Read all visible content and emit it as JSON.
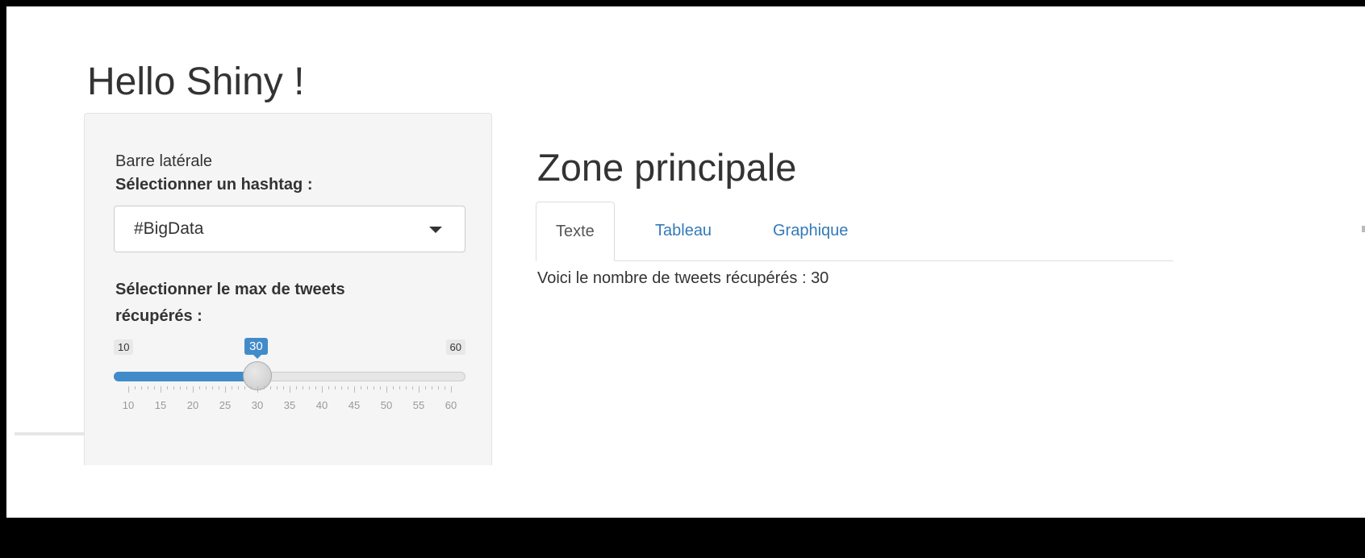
{
  "app": {
    "title": "Hello Shiny !"
  },
  "sidebar": {
    "caption": "Barre latérale",
    "hashtag_label": "Sélectionner un hashtag :",
    "hashtag_value": "#BigData",
    "max_label_line1": "Sélectionner le max de tweets",
    "max_label_line2": "récupérés :",
    "slider": {
      "min": 10,
      "max": 60,
      "value": 30,
      "min_label": "10",
      "max_label": "60",
      "value_label": "30",
      "tick_labels": [
        "10",
        "15",
        "20",
        "25",
        "30",
        "35",
        "40",
        "45",
        "50",
        "55",
        "60"
      ],
      "accent_color": "#428bca"
    }
  },
  "main": {
    "title": "Zone principale",
    "tabs": [
      {
        "label": "Texte",
        "active": true
      },
      {
        "label": "Tableau",
        "active": false
      },
      {
        "label": "Graphique",
        "active": false
      }
    ],
    "content_text": "Voici le nombre de tweets récupérés : 30"
  }
}
